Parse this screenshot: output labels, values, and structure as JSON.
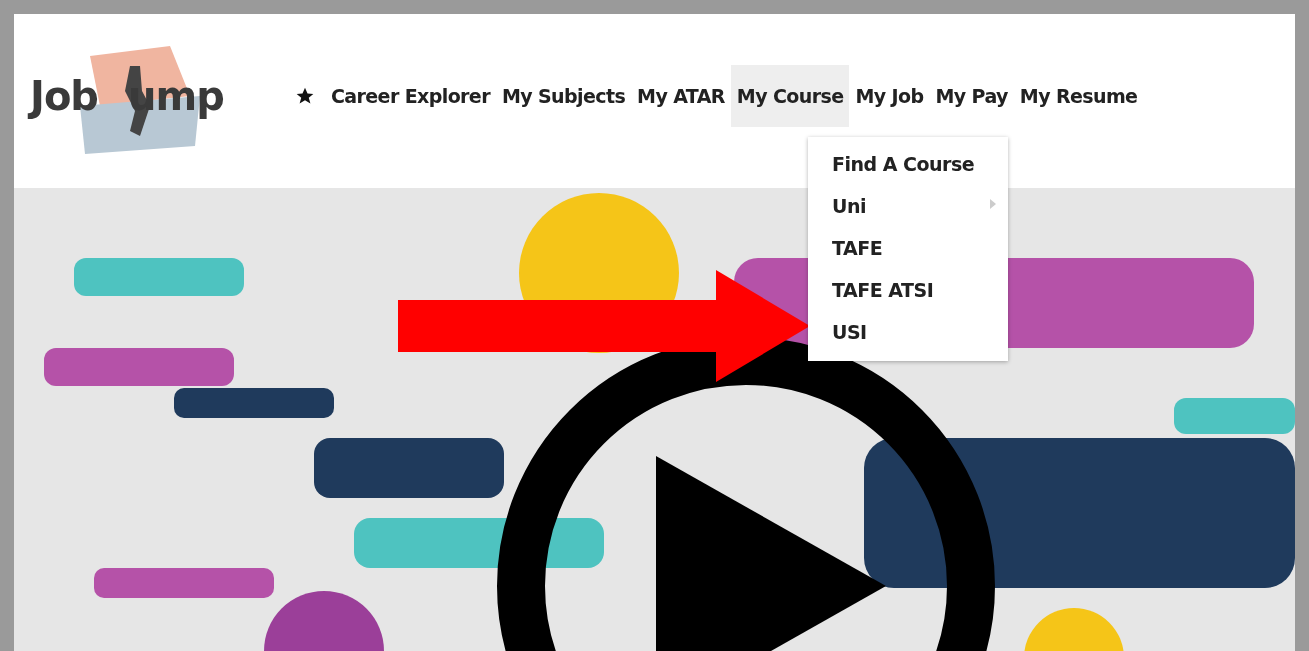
{
  "logo": {
    "left": "Job",
    "right": "ump"
  },
  "nav": [
    {
      "label": "Career Explorer",
      "selected": false,
      "starred": true
    },
    {
      "label": "My Subjects",
      "selected": false,
      "starred": false
    },
    {
      "label": "My ATAR",
      "selected": false,
      "starred": false
    },
    {
      "label": "My Course",
      "selected": true,
      "starred": false
    },
    {
      "label": "My Job",
      "selected": false,
      "starred": false
    },
    {
      "label": "My Pay",
      "selected": false,
      "starred": false
    },
    {
      "label": "My Resume",
      "selected": false,
      "starred": false
    }
  ],
  "dropdown": [
    {
      "label": "Find A Course",
      "has_submenu": false
    },
    {
      "label": "Uni",
      "has_submenu": true
    },
    {
      "label": "TAFE",
      "has_submenu": false
    },
    {
      "label": "TAFE ATSI",
      "has_submenu": false
    },
    {
      "label": "USI",
      "has_submenu": false
    }
  ]
}
